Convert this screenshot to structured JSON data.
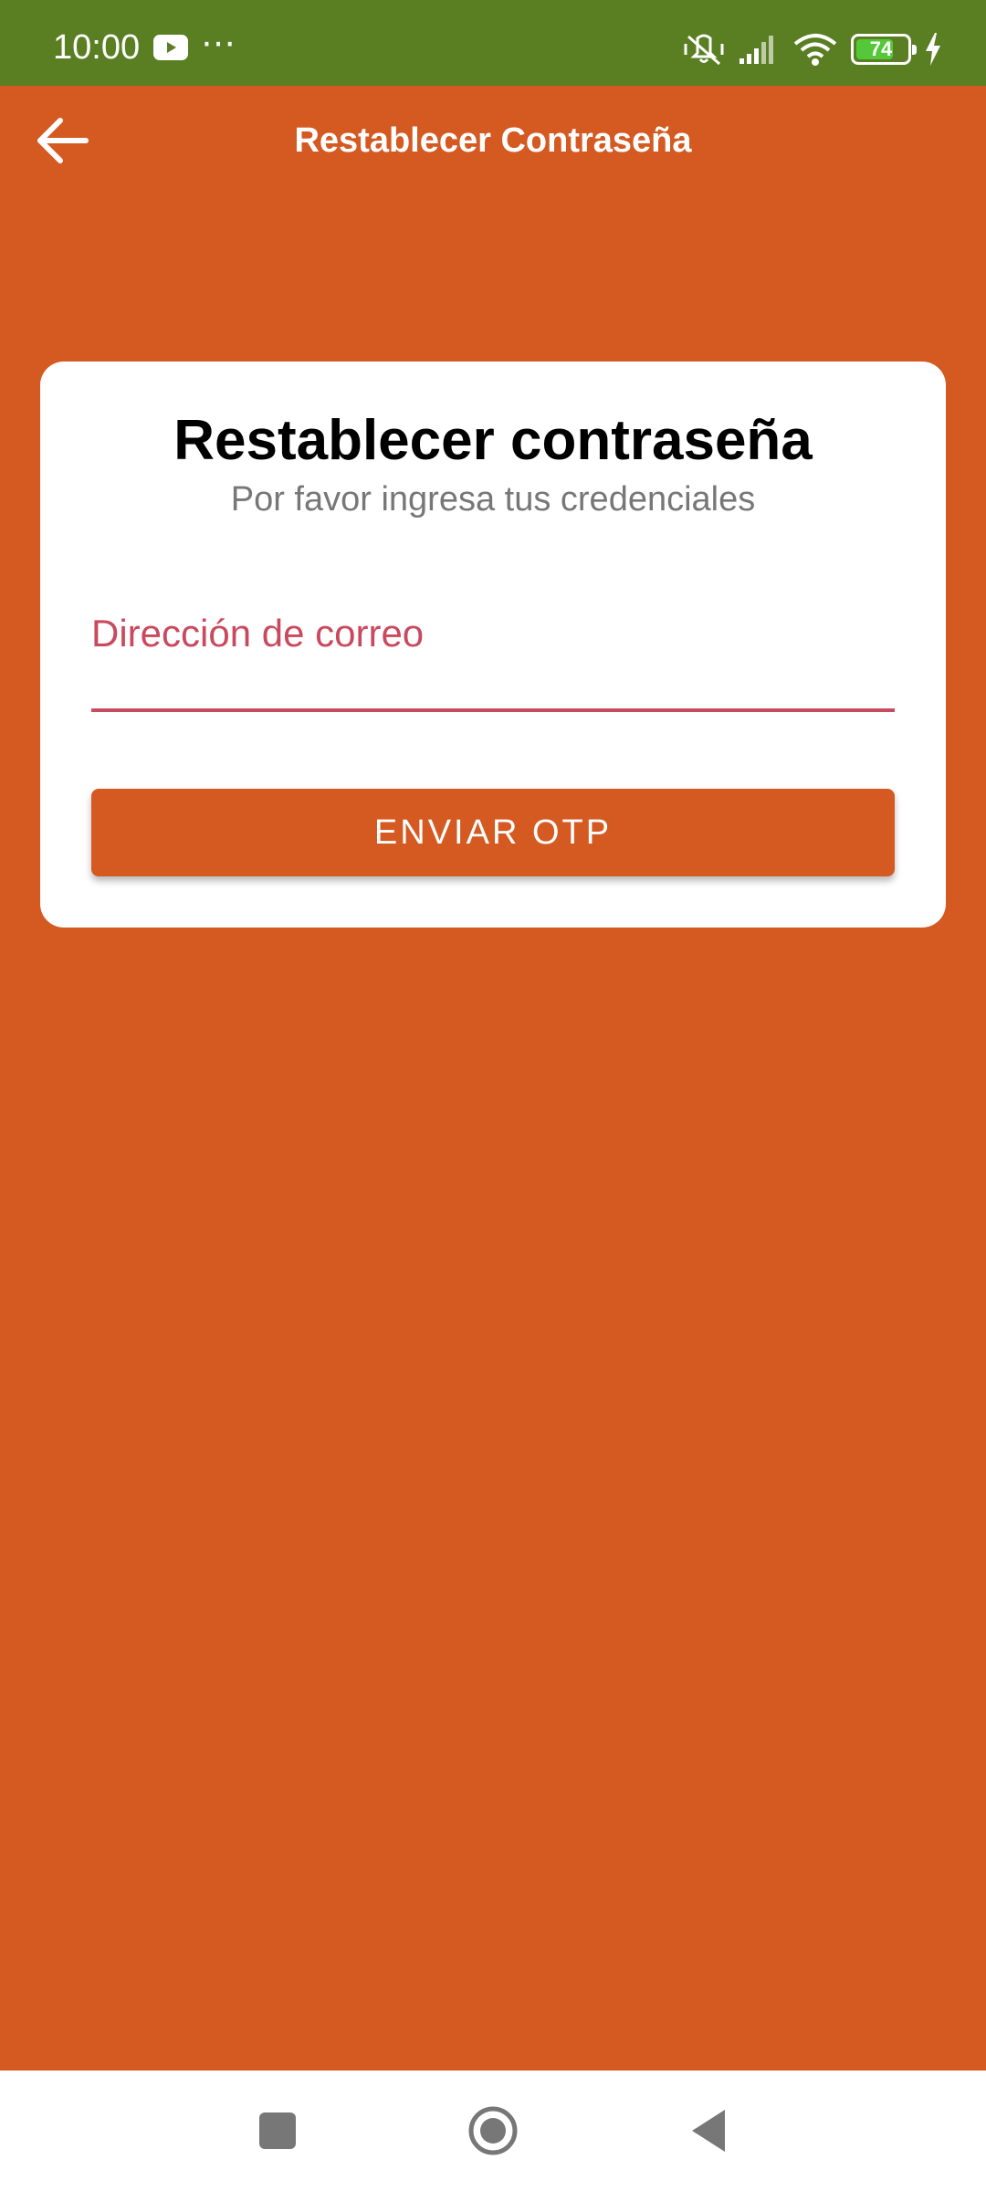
{
  "status_bar": {
    "time": "10:00",
    "more": "⋯",
    "battery_level": "74",
    "battery_fraction": 0.74,
    "icons": [
      "youtube-icon",
      "vibrate-off-icon",
      "signal-icon",
      "wifi-icon",
      "battery-icon",
      "charging-icon"
    ]
  },
  "app_bar": {
    "title": "Restablecer Contraseña",
    "back_icon": "arrow-left-icon"
  },
  "card": {
    "title": "Restablecer contraseña",
    "subtitle": "Por favor ingresa tus credenciales",
    "email_placeholder": "Dirección de correo",
    "email_value": "",
    "send_button_label": "ENVIAR OTP"
  },
  "nav_bar": {
    "buttons": [
      "recents-icon",
      "home-icon",
      "back-icon"
    ]
  },
  "colors": {
    "status_bar": "#5A7E22",
    "background": "#D45A22",
    "accent": "#C94A5E",
    "card": "#FFFFFF",
    "button": "#D45A22"
  }
}
